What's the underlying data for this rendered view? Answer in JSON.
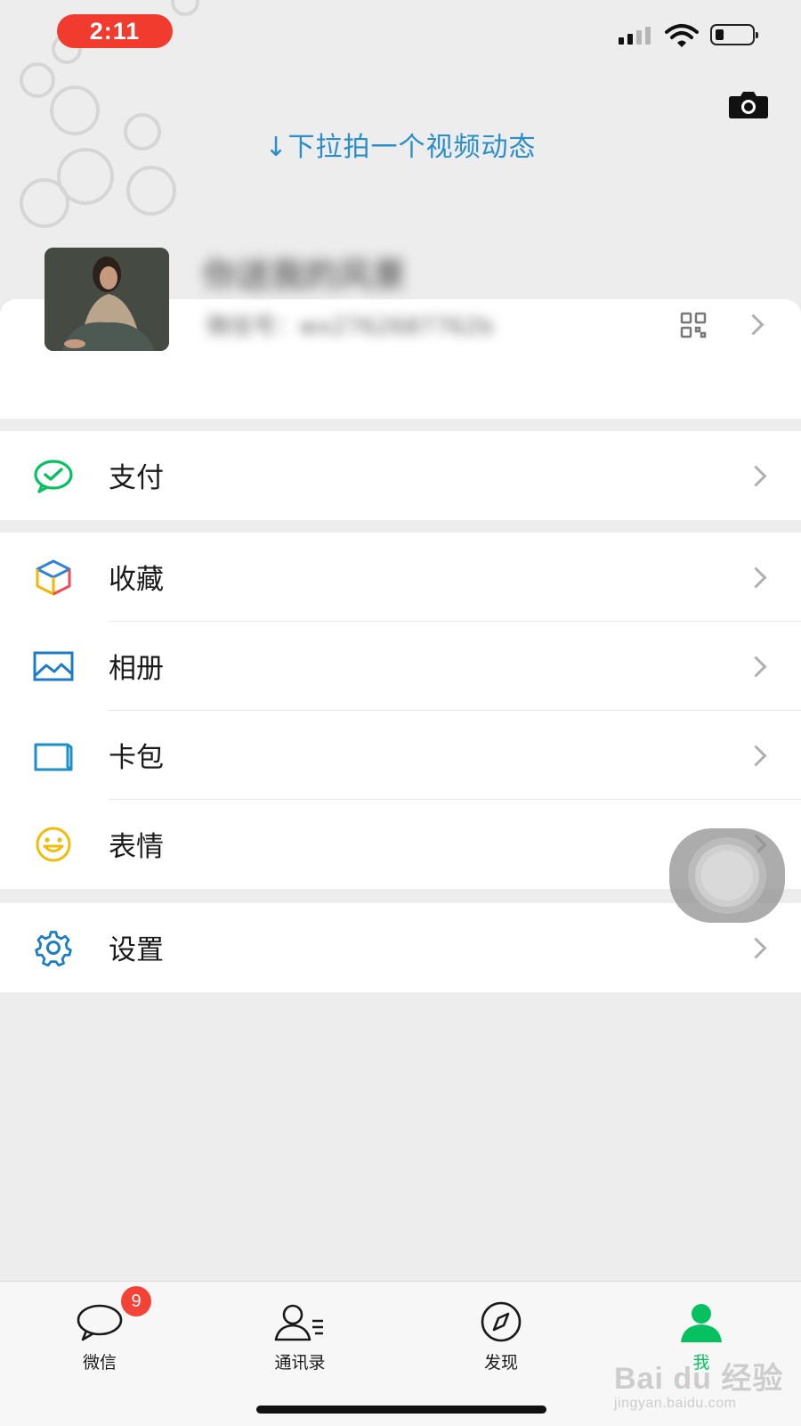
{
  "status_bar": {
    "time": "2:11",
    "colors": {
      "time_pill": "#f23b2f"
    }
  },
  "header": {
    "pull_hint": "↓下拉拍一个视频动态",
    "camera_icon": "camera-icon",
    "hint_color": "#2a8ec8"
  },
  "profile": {
    "nickname": "你送我的风景",
    "wechat_id": "微信号：wx2762687762b",
    "qr_icon": "qr-code-icon"
  },
  "menu": {
    "pay": {
      "label": "支付",
      "icon": "wechat-pay-icon"
    },
    "favorites": {
      "label": "收藏",
      "icon": "favorites-cube-icon"
    },
    "album": {
      "label": "相册",
      "icon": "album-icon"
    },
    "cards": {
      "label": "卡包",
      "icon": "card-wallet-icon"
    },
    "stickers": {
      "label": "表情",
      "icon": "smiley-icon"
    },
    "settings": {
      "label": "设置",
      "icon": "gear-icon"
    }
  },
  "tabbar": {
    "chats": {
      "label": "微信",
      "badge": "9",
      "icon": "chat-bubble-icon"
    },
    "contacts": {
      "label": "通讯录",
      "icon": "contacts-icon"
    },
    "discover": {
      "label": "发现",
      "icon": "compass-icon"
    },
    "me": {
      "label": "我",
      "icon": "person-icon",
      "active": true
    }
  },
  "watermark": {
    "brand": "Bai du 经验",
    "url": "jingyan.baidu.com"
  },
  "colors": {
    "accent_green": "#07c160",
    "badge_red": "#f44236",
    "background": "#ededed"
  }
}
